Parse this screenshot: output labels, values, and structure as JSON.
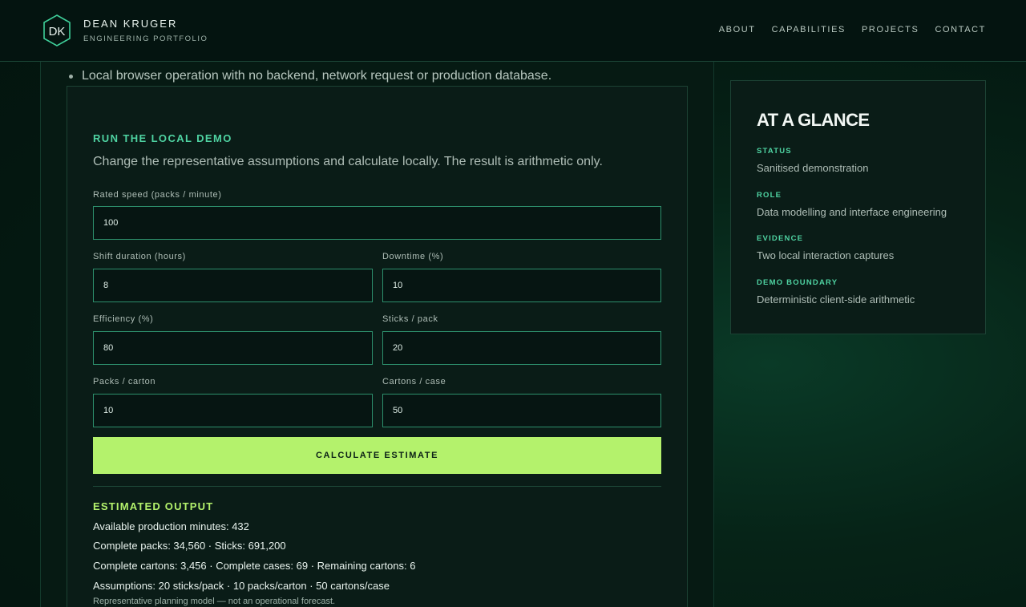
{
  "header": {
    "brand_name": "DEAN KRUGER",
    "brand_subtitle": "ENGINEERING PORTFOLIO",
    "logo_text": "DK",
    "nav": [
      {
        "label": "ABOUT"
      },
      {
        "label": "CAPABILITIES"
      },
      {
        "label": "PROJECTS"
      },
      {
        "label": "CONTACT"
      }
    ]
  },
  "bullet": "Local browser operation with no backend, network request or production database.",
  "demo": {
    "eyebrow": "RUN THE LOCAL DEMO",
    "intro": "Change the representative assumptions and calculate locally. The result is arithmetic only.",
    "fields": {
      "rated_speed": {
        "label": "Rated speed (packs / minute)",
        "value": "100"
      },
      "shift_duration": {
        "label": "Shift duration (hours)",
        "value": "8"
      },
      "downtime": {
        "label": "Downtime (%)",
        "value": "10"
      },
      "efficiency": {
        "label": "Efficiency (%)",
        "value": "80"
      },
      "sticks_per_pack": {
        "label": "Sticks / pack",
        "value": "20"
      },
      "packs_per_carton": {
        "label": "Packs / carton",
        "value": "10"
      },
      "cartons_per_case": {
        "label": "Cartons / case",
        "value": "50"
      }
    },
    "button_label": "CALCULATE ESTIMATE",
    "output": {
      "title": "ESTIMATED OUTPUT",
      "lines": [
        "Available production minutes: 432",
        "Complete packs: 34,560 · Sticks: 691,200",
        "Complete cartons: 3,456 · Complete cases: 69 · Remaining cartons: 6",
        "Assumptions: 20 sticks/pack · 10 packs/carton · 50 cartons/case"
      ],
      "note": "Representative planning model — not an operational forecast."
    }
  },
  "glance": {
    "title": "AT A GLANCE",
    "items": [
      {
        "label": "STATUS",
        "value": "Sanitised demonstration"
      },
      {
        "label": "ROLE",
        "value": "Data modelling and interface engineering"
      },
      {
        "label": "EVIDENCE",
        "value": "Two local interaction captures"
      },
      {
        "label": "DEMO BOUNDARY",
        "value": "Deterministic client-side arithmetic"
      }
    ]
  },
  "colors": {
    "accent_green": "#4fd3a2",
    "button_lime": "#b4f26c",
    "background": "#041811"
  }
}
